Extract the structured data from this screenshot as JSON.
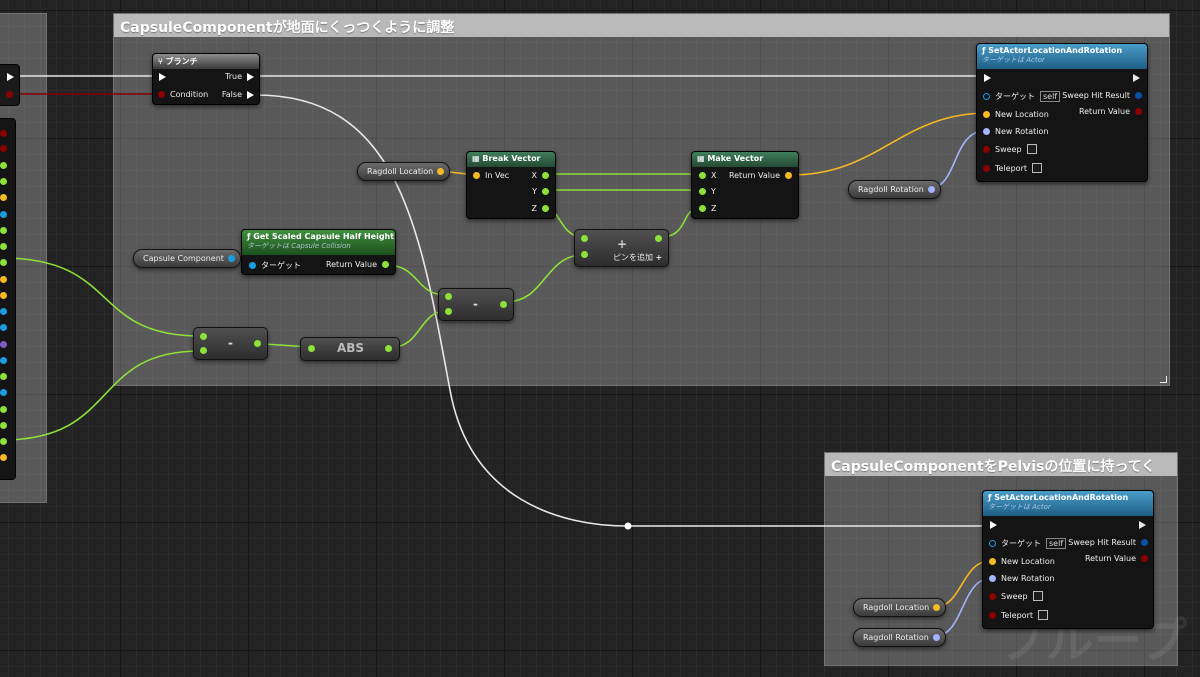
{
  "comments": {
    "top": "CapsuleComponentが地面にくっつくように調整",
    "bottom": "CapsuleComponentをPelvisの位置に持ってく"
  },
  "branch": {
    "title": "ブランチ",
    "true_label": "True",
    "condition_label": "Condition",
    "false_label": "False"
  },
  "set_actor_top": {
    "title": "SetActorLocationAndRotation",
    "subtitle": "ターゲットは Actor",
    "target_label": "ターゲット",
    "self_label": "self",
    "sweep_hit_label": "Sweep Hit Result",
    "return_label": "Return Value",
    "new_location_label": "New Location",
    "new_rotation_label": "New Rotation",
    "sweep_label": "Sweep",
    "teleport_label": "Teleport"
  },
  "set_actor_bottom": {
    "title": "SetActorLocationAndRotation",
    "subtitle": "ターゲットは Actor",
    "target_label": "ターゲット",
    "self_label": "self",
    "sweep_hit_label": "Sweep Hit Result",
    "return_label": "Return Value",
    "new_location_label": "New Location",
    "new_rotation_label": "New Rotation",
    "sweep_label": "Sweep",
    "teleport_label": "Teleport"
  },
  "break_vector": {
    "title": "Break Vector",
    "in_label": "In Vec",
    "x_label": "X",
    "y_label": "Y",
    "z_label": "Z"
  },
  "make_vector": {
    "title": "Make Vector",
    "x_label": "X",
    "y_label": "Y",
    "z_label": "Z",
    "return_label": "Return Value"
  },
  "capsule_height": {
    "title": "Get Scaled Capsule Half Height",
    "subtitle": "ターゲットは Capsule Collision",
    "target_label": "ターゲット",
    "return_label": "Return Value"
  },
  "variables": {
    "ragdoll_location_1": "Ragdoll Location",
    "ragdoll_rotation_1": "Ragdoll Rotation",
    "capsule_component": "Capsule Component",
    "ragdoll_location_2": "Ragdoll Location",
    "ragdoll_rotation_2": "Ragdoll Rotation"
  },
  "ops": {
    "minus_1": "-",
    "minus_2": "-",
    "abs": "ABS",
    "plus": "+",
    "add_pin": "ピンを追加"
  },
  "watermark": "ブループ",
  "colors": {
    "exec": "#ffffff",
    "bool": "#8b0000",
    "float": "#8ee03a",
    "vector": "#f4b923",
    "rotator": "#a0b4ff",
    "object": "#1a9ce0",
    "func_header": "#2b6f99",
    "comment_title": "#b9b9b9"
  }
}
